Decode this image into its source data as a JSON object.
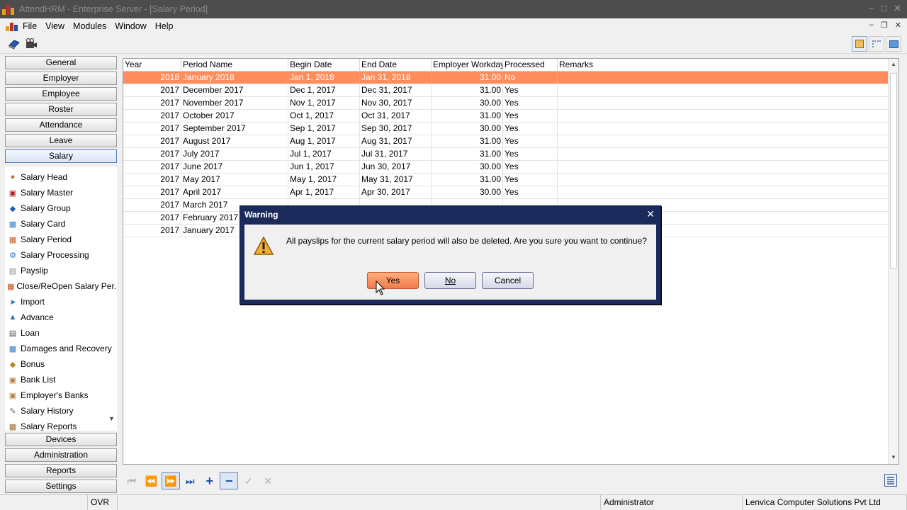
{
  "window": {
    "title": "AttendHRM - Enterprise Server - [Salary Period]"
  },
  "menu": [
    "File",
    "View",
    "Modules",
    "Window",
    "Help"
  ],
  "sidebar": {
    "top_buttons": [
      "General",
      "Employer",
      "Employee",
      "Roster",
      "Attendance",
      "Leave",
      "Salary"
    ],
    "active": "Salary",
    "salary_items": [
      {
        "label": "Salary Head",
        "icon": "salary-head-icon"
      },
      {
        "label": "Salary Master",
        "icon": "salary-master-icon"
      },
      {
        "label": "Salary Group",
        "icon": "salary-group-icon"
      },
      {
        "label": "Salary Card",
        "icon": "salary-card-icon"
      },
      {
        "label": "Salary Period",
        "icon": "calendar-icon"
      },
      {
        "label": "Salary Processing",
        "icon": "gear-icon"
      },
      {
        "label": "Payslip",
        "icon": "document-icon"
      },
      {
        "label": "Close/ReOpen Salary Per...",
        "icon": "close-reopen-icon"
      },
      {
        "label": "Import",
        "icon": "import-icon"
      },
      {
        "label": "Advance",
        "icon": "advance-icon"
      },
      {
        "label": "Loan",
        "icon": "loan-icon"
      },
      {
        "label": "Damages and Recovery",
        "icon": "damages-icon"
      },
      {
        "label": "Bonus",
        "icon": "bonus-icon"
      },
      {
        "label": "Bank List",
        "icon": "bank-icon"
      },
      {
        "label": "Employer's Banks",
        "icon": "employer-bank-icon"
      },
      {
        "label": "Salary History",
        "icon": "history-icon"
      },
      {
        "label": "Salary Reports",
        "icon": "reports-icon"
      }
    ],
    "bottom_buttons": [
      "Devices",
      "Administration",
      "Reports",
      "Settings"
    ]
  },
  "grid": {
    "columns": [
      "Year",
      "Period Name",
      "Begin Date",
      "End Date",
      "Employer Workdays",
      "Processed",
      "Remarks"
    ],
    "rows": [
      [
        "2018",
        "January 2018",
        "Jan 1, 2018",
        "Jan 31, 2018",
        "31.00",
        "No",
        ""
      ],
      [
        "2017",
        "December 2017",
        "Dec 1, 2017",
        "Dec 31, 2017",
        "31.00",
        "Yes",
        ""
      ],
      [
        "2017",
        "November 2017",
        "Nov 1, 2017",
        "Nov 30, 2017",
        "30.00",
        "Yes",
        ""
      ],
      [
        "2017",
        "October 2017",
        "Oct 1, 2017",
        "Oct 31, 2017",
        "31.00",
        "Yes",
        ""
      ],
      [
        "2017",
        "September 2017",
        "Sep 1, 2017",
        "Sep 30, 2017",
        "30.00",
        "Yes",
        ""
      ],
      [
        "2017",
        "August 2017",
        "Aug 1, 2017",
        "Aug 31, 2017",
        "31.00",
        "Yes",
        ""
      ],
      [
        "2017",
        "July 2017",
        "Jul 1, 2017",
        "Jul 31, 2017",
        "31.00",
        "Yes",
        ""
      ],
      [
        "2017",
        "June 2017",
        "Jun 1, 2017",
        "Jun 30, 2017",
        "30.00",
        "Yes",
        ""
      ],
      [
        "2017",
        "May 2017",
        "May 1, 2017",
        "May 31, 2017",
        "31.00",
        "Yes",
        ""
      ],
      [
        "2017",
        "April 2017",
        "Apr 1, 2017",
        "Apr 30, 2017",
        "30.00",
        "Yes",
        ""
      ],
      [
        "2017",
        "March 2017",
        "",
        "",
        "",
        "",
        ""
      ],
      [
        "2017",
        "February 2017",
        "",
        "",
        "",
        "",
        ""
      ],
      [
        "2017",
        "January 2017",
        "",
        "",
        "",
        "",
        ""
      ]
    ],
    "selected_row": 0
  },
  "navigator": [
    "first",
    "prior",
    "next-page",
    "last",
    "insert",
    "delete",
    "post",
    "cancel"
  ],
  "dialog": {
    "title": "Warning",
    "message": "All payslips for the current salary period will also be deleted. Are you sure you want to continue?",
    "buttons": {
      "yes": "Yes",
      "no": "No",
      "cancel": "Cancel"
    }
  },
  "status": {
    "mode": "OVR",
    "user": "Administrator",
    "company": "Lenvica Computer Solutions Pvt Ltd"
  },
  "colors": {
    "selection": "#ff8c5c",
    "dialog_frame": "#1a2a5a",
    "accent": "#1e4fa8"
  }
}
